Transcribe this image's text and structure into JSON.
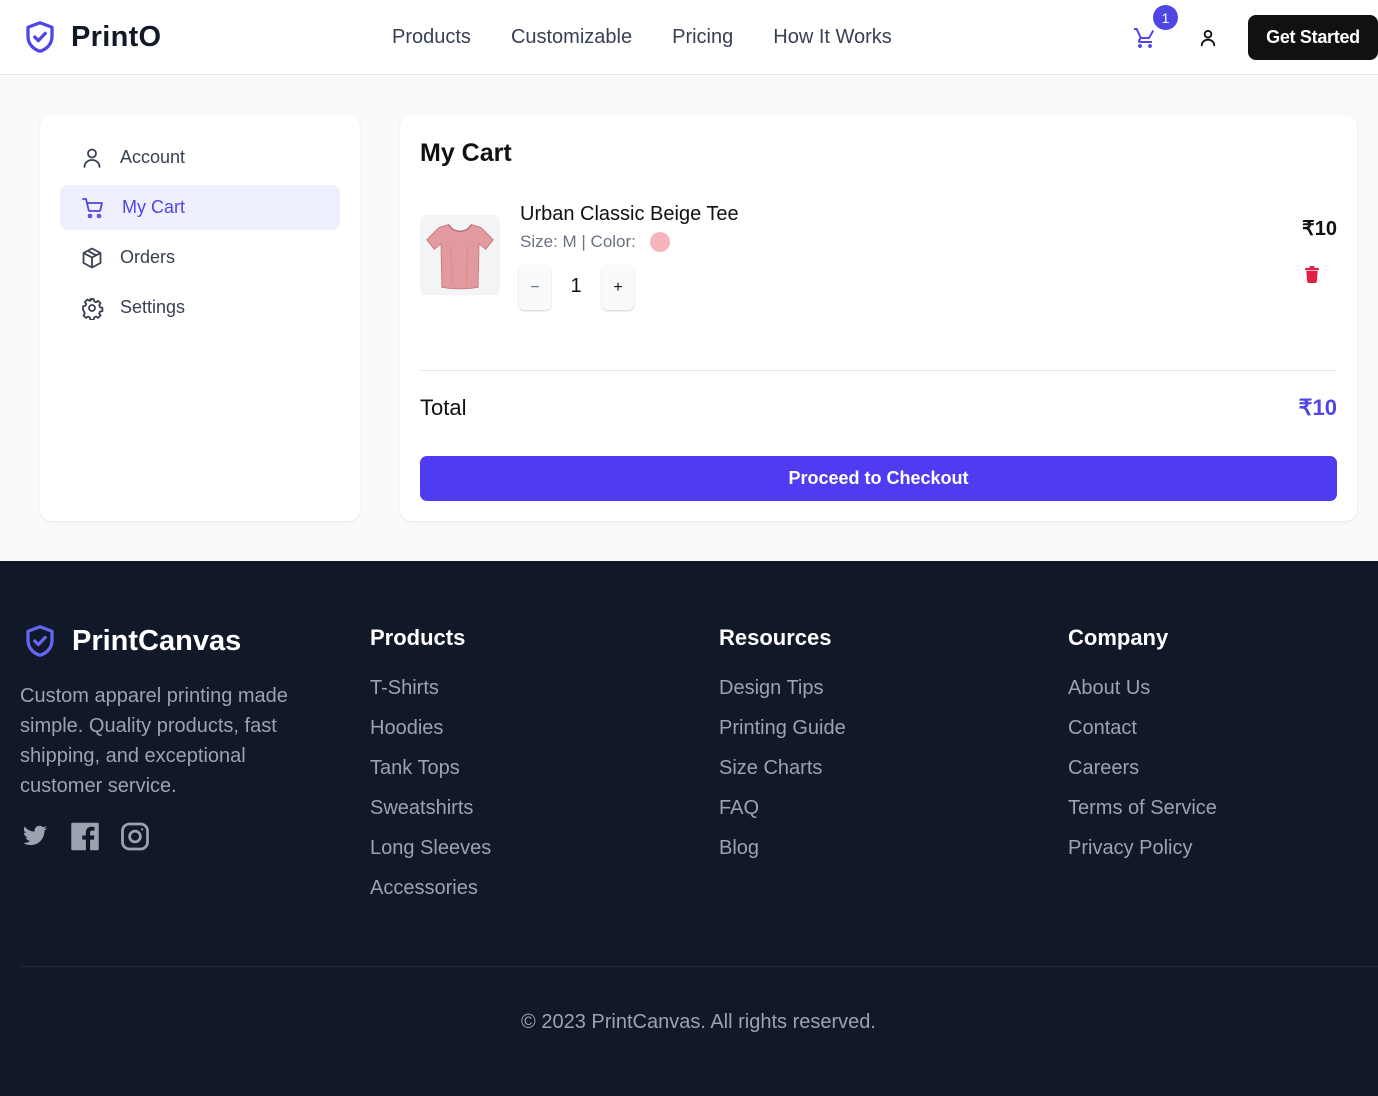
{
  "header": {
    "brand": "PrintO",
    "nav": [
      "Products",
      "Customizable",
      "Pricing",
      "How It Works"
    ],
    "cart_count": "1",
    "cta": "Get Started"
  },
  "sidebar": {
    "items": [
      {
        "label": "Account",
        "icon": "user-icon",
        "active": false
      },
      {
        "label": "My Cart",
        "icon": "cart-icon",
        "active": true
      },
      {
        "label": "Orders",
        "icon": "box-icon",
        "active": false
      },
      {
        "label": "Settings",
        "icon": "gear-icon",
        "active": false
      }
    ]
  },
  "cart": {
    "title": "My Cart",
    "item": {
      "name": "Urban Classic Beige Tee",
      "meta": "Size: M | Color:",
      "color_swatch": "#f5b5bd",
      "quantity": "1",
      "price": "₹10"
    },
    "total_label": "Total",
    "total_value": "₹10",
    "checkout_label": "Proceed to Checkout"
  },
  "footer": {
    "brand": "PrintCanvas",
    "description": "Custom apparel printing made simple. Quality products, fast shipping, and exceptional customer service.",
    "socials": [
      "twitter-icon",
      "facebook-icon",
      "instagram-icon"
    ],
    "columns": [
      {
        "title": "Products",
        "links": [
          "T-Shirts",
          "Hoodies",
          "Tank Tops",
          "Sweatshirts",
          "Long Sleeves",
          "Accessories"
        ]
      },
      {
        "title": "Resources",
        "links": [
          "Design Tips",
          "Printing Guide",
          "Size Charts",
          "FAQ",
          "Blog"
        ]
      },
      {
        "title": "Company",
        "links": [
          "About Us",
          "Contact",
          "Careers",
          "Terms of Service",
          "Privacy Policy"
        ]
      }
    ],
    "copyright": "© 2023 PrintCanvas. All rights reserved."
  },
  "colors": {
    "accent": "#4f46e5",
    "dark": "#111827",
    "danger": "#e11d48"
  }
}
